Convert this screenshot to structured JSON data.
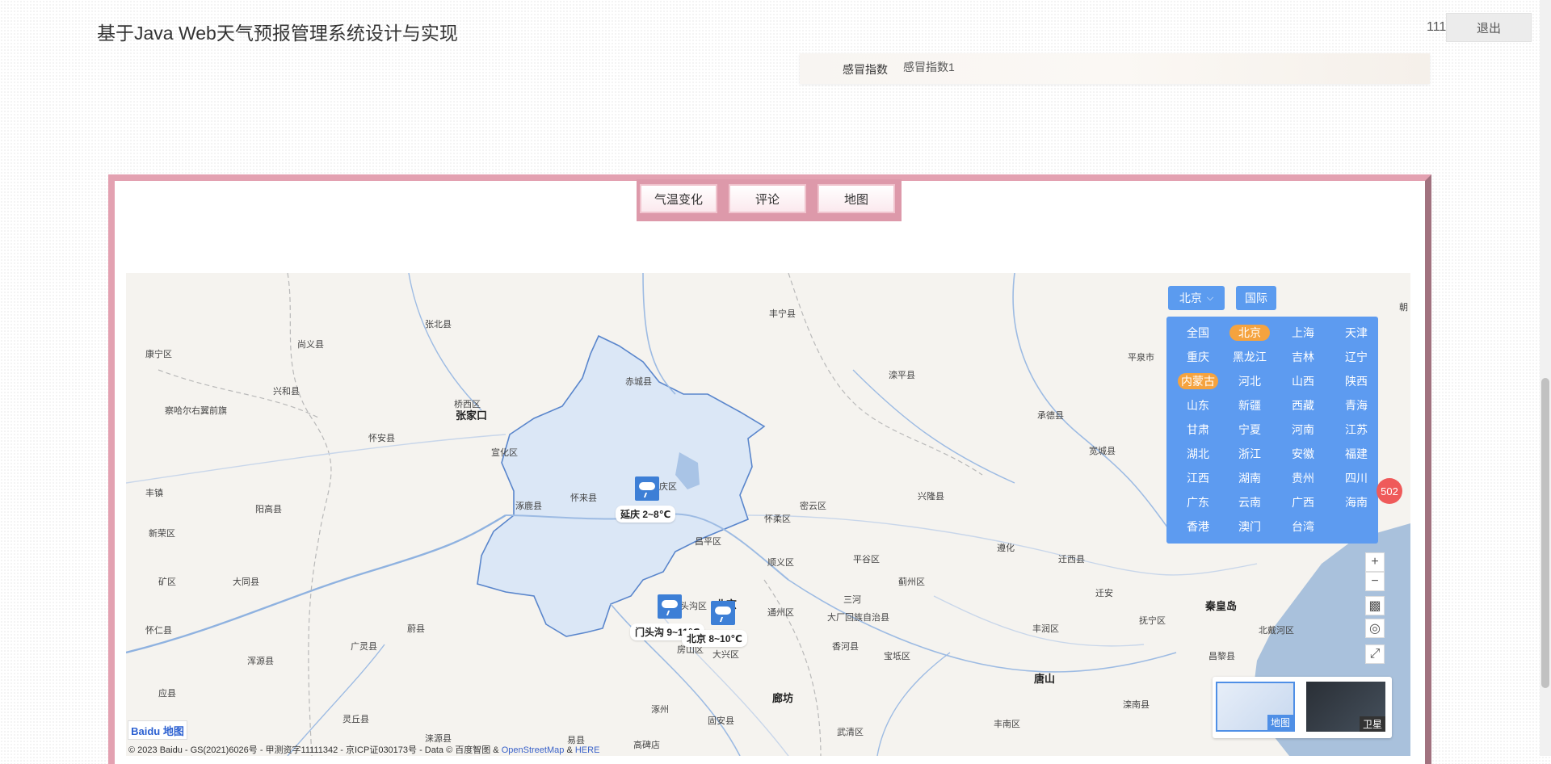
{
  "header": {
    "title": "基于Java Web天气预报管理系统设计与实现",
    "user": "111",
    "logout_label": "退出"
  },
  "cold_index": {
    "label": "感冒指数",
    "value": "感冒指数1"
  },
  "tabs": [
    {
      "label": "气温变化"
    },
    {
      "label": "评论"
    },
    {
      "label": "地图"
    }
  ],
  "map": {
    "city_selected": "北京",
    "intl_label": "国际",
    "provinces": [
      "全国",
      "北京",
      "上海",
      "天津",
      "重庆",
      "黑龙江",
      "吉林",
      "辽宁",
      "内蒙古",
      "河北",
      "山西",
      "陕西",
      "山东",
      "新疆",
      "西藏",
      "青海",
      "甘肃",
      "宁夏",
      "河南",
      "江苏",
      "湖北",
      "浙江",
      "安徽",
      "福建",
      "江西",
      "湖南",
      "贵州",
      "四川",
      "广东",
      "云南",
      "广西",
      "海南",
      "香港",
      "澳门",
      "台湾"
    ],
    "active_provinces": [
      "北京",
      "内蒙古"
    ],
    "weather": [
      {
        "label": "延庆 2~8℃"
      },
      {
        "label": "门头沟 9~11℃"
      },
      {
        "label": "北京 8~10℃"
      }
    ],
    "places": [
      "康宁区",
      "尚义县",
      "张北县",
      "丰宁县",
      "滦平县",
      "平泉市",
      "朝",
      "兴和县",
      "赤城县",
      "桥西区",
      "张家口",
      "察哈尔右翼前旗",
      "怀安县",
      "宣化区",
      "承德县",
      "宽城县",
      "兴隆县",
      "丰镇",
      "阳高县",
      "怀来县",
      "涿鹿县",
      "庆区",
      "怀柔区",
      "密云区",
      "新荣区",
      "昌平区",
      "顺义区",
      "平谷区",
      "遵化",
      "迁西县",
      "蓟州区",
      "矿区",
      "大同县",
      "头沟区",
      "北京",
      "迁安",
      "秦皇岛",
      "怀仁县",
      "蔚县",
      "广灵县",
      "通州区",
      "大厂回族自治县",
      "三河",
      "丰润区",
      "抚宁区",
      "北戴河区",
      "浑源县",
      "房山区",
      "大兴区",
      "香河县",
      "宝坻区",
      "昌黎县",
      "应县",
      "廊坊",
      "唐山",
      "灵丘县",
      "涿州",
      "固安县",
      "丰南区",
      "滦南县",
      "涞源县",
      "易县",
      "高碑店",
      "武清区"
    ],
    "badge": "502",
    "zoom_in": "+",
    "zoom_out": "−",
    "map_types": [
      {
        "label": "地图"
      },
      {
        "label": "卫星"
      }
    ],
    "logo": "Baidu 地图",
    "copyright": "© 2023 Baidu - GS(2021)6026号 - 甲测资字11111342 - 京ICP证030173号 - Data © 百度智图 &",
    "copyright_link1": "OpenStreetMap",
    "copyright_amp": "&",
    "copyright_link2": "HERE"
  },
  "colors": {
    "accent": "#5b9bef",
    "active": "#f5a33f",
    "frame": "#e3a1b1",
    "badge": "#ef5a5a"
  }
}
